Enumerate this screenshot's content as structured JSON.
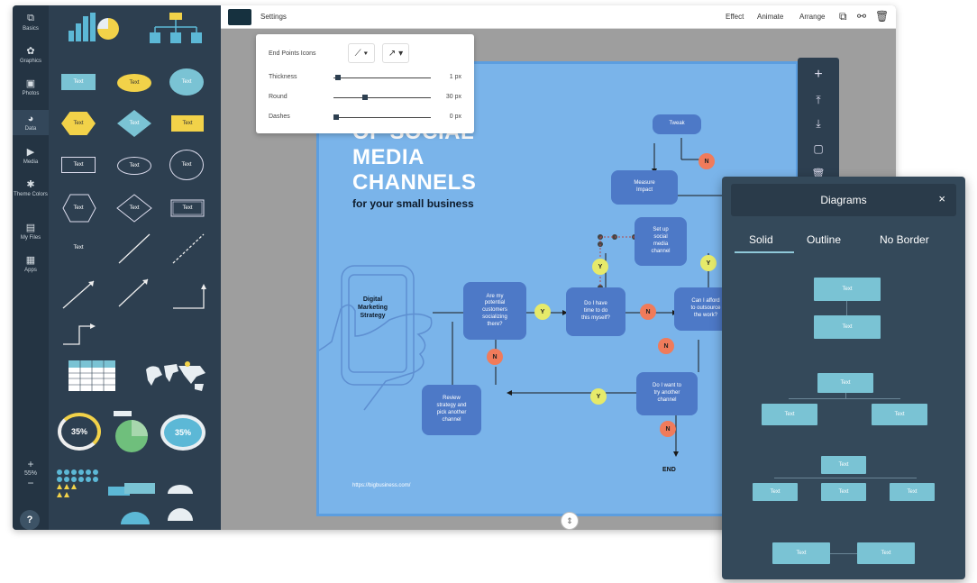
{
  "rail": {
    "items": [
      {
        "label": "Basics",
        "icon": "shapes-icon"
      },
      {
        "label": "Graphics",
        "icon": "graphics-icon"
      },
      {
        "label": "Photos",
        "icon": "photo-icon"
      },
      {
        "label": "Data",
        "icon": "pie-chart-icon"
      },
      {
        "label": "Media",
        "icon": "media-icon"
      },
      {
        "label": "Theme Colors",
        "icon": "palette-icon"
      },
      {
        "label": "My Files",
        "icon": "folder-icon"
      },
      {
        "label": "Apps",
        "icon": "apps-icon"
      }
    ],
    "zoom_plus": "+",
    "zoom_value": "55%",
    "zoom_minus": "−",
    "help": "?"
  },
  "panel": {
    "text_label": "Text",
    "gauge_value": "35%",
    "gauge_value_2": "35%"
  },
  "topbar": {
    "settings": "Settings",
    "effect": "Effect",
    "animate": "Animate",
    "arrange": "Arrange"
  },
  "settings_popup": {
    "end_points_label": "End Points Icons",
    "thickness_label": "Thickness",
    "thickness_value": "1 px",
    "thickness": 0.02,
    "round_label": "Round",
    "round_value": "30 px",
    "round": 0.3,
    "dashes_label": "Dashes",
    "dashes_value": "0 px",
    "dashes": 0.0
  },
  "canvas": {
    "title_line_1": "OF SOCIAL",
    "title_line_2": "MEDIA",
    "title_line_3": "CHANNELS",
    "subtitle": "for your small business",
    "phone_label": "Digital\nMarketing\nStrategy",
    "url": "https://bigbusiness.com/",
    "nodes": {
      "tweak": "Tweak",
      "measure": "Measure\nImpact",
      "set_up": "Set up\nsocial\nmedia\nchannel",
      "are_my": "Are my\npotential\ncustomers\nsocializing\nthere?",
      "do_i_have": "Do I have\ntime to do\nthis myself?",
      "can_i_afford": "Can I afford\nto outsource\nthe work?",
      "review": "Review\nstrategy and\npick another\nchannel",
      "do_i_want": "Do I want to\ntry another\nchannel"
    },
    "badge_n": "N",
    "badge_y": "Y",
    "end": "END"
  },
  "diagrams": {
    "title": "Diagrams",
    "close": "×",
    "tabs": [
      "Solid",
      "Outline",
      "No Border"
    ],
    "box_label": "Text"
  },
  "colors": {
    "panel_bg": "#2d3f50",
    "canvas_bg": "#7ab4ea",
    "node": "#4d79c7",
    "badge_n": "#f07b5b",
    "badge_y": "#e6ea6a",
    "diagram_box": "#7ac3d4"
  }
}
